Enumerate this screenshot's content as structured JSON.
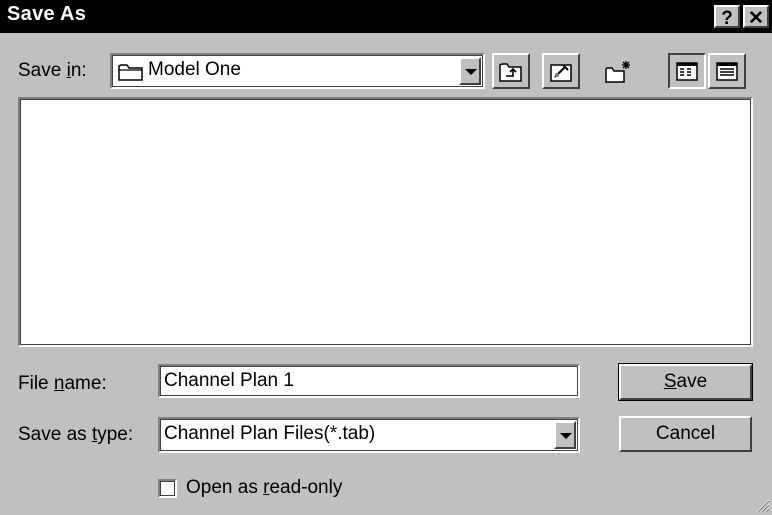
{
  "window": {
    "title": "Save As",
    "help_label": "?",
    "close_label": "✕"
  },
  "save_in": {
    "label_prefix": "Save ",
    "label_key": "i",
    "label_suffix": "n:",
    "value": "Model One"
  },
  "toolbar": {
    "up_one_level": "up-folder-icon",
    "desktop": "desktop-icon",
    "new_folder": "new-folder-icon",
    "list_view": "list-view-icon",
    "details_view": "details-view-icon"
  },
  "file_name": {
    "label_prefix": "File ",
    "label_key": "n",
    "label_suffix": "ame:",
    "value": "Channel Plan 1"
  },
  "save_as_type": {
    "label_prefix": "Save as ",
    "label_key": "t",
    "label_suffix": "ype:",
    "value": "Channel Plan Files(*.tab)"
  },
  "buttons": {
    "save_key": "S",
    "save_rest": "ave",
    "cancel": "Cancel"
  },
  "read_only": {
    "label_prefix": "Open as ",
    "label_key": "r",
    "label_suffix": "ead-only",
    "checked": false
  }
}
